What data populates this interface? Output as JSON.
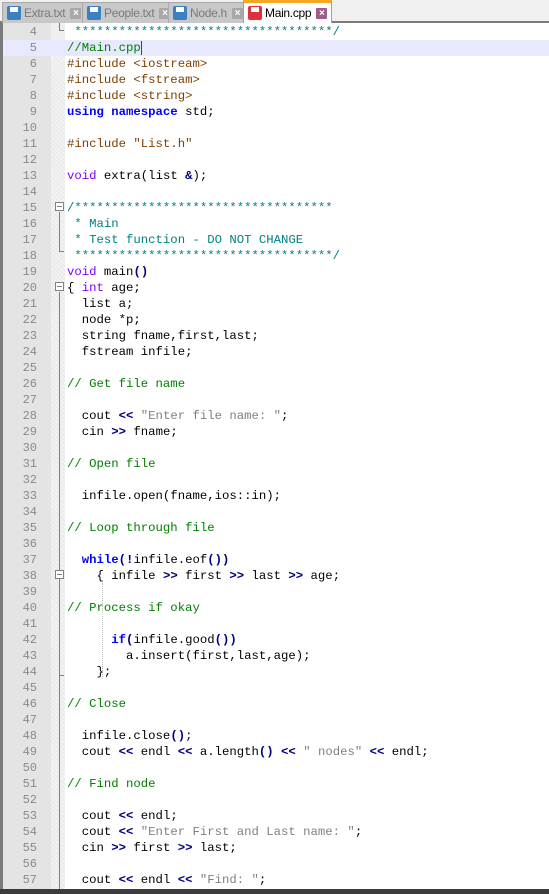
{
  "tabs": [
    {
      "label": "Extra.txt",
      "icon": "floppy-disk-icon",
      "state": "saved",
      "active": false
    },
    {
      "label": "People.txt",
      "icon": "floppy-disk-icon",
      "state": "saved",
      "active": false
    },
    {
      "label": "Node.h",
      "icon": "floppy-disk-icon",
      "state": "saved",
      "active": false
    },
    {
      "label": "Main.cpp",
      "icon": "floppy-disk-icon",
      "state": "modified",
      "active": true
    }
  ],
  "editor": {
    "current_line": 5,
    "lines": [
      {
        "n": "4",
        "tokens": [
          [
            " ***********************************/",
            "cmb"
          ]
        ]
      },
      {
        "n": "5",
        "tokens": [
          [
            "//Main.cpp",
            "cm"
          ]
        ]
      },
      {
        "n": "6",
        "tokens": [
          [
            "#include <iostream>",
            "pp"
          ]
        ]
      },
      {
        "n": "7",
        "tokens": [
          [
            "#include <fstream>",
            "pp"
          ]
        ]
      },
      {
        "n": "8",
        "tokens": [
          [
            "#include <string>",
            "pp"
          ]
        ]
      },
      {
        "n": "9",
        "tokens": [
          [
            "using namespace",
            "kw"
          ],
          [
            " std;",
            "id"
          ]
        ]
      },
      {
        "n": "10",
        "tokens": []
      },
      {
        "n": "11",
        "tokens": [
          [
            "#include \"List.h\"",
            "pp"
          ]
        ]
      },
      {
        "n": "12",
        "tokens": []
      },
      {
        "n": "13",
        "tokens": [
          [
            "void",
            "type"
          ],
          [
            " extra(list ",
            "id"
          ],
          [
            "&",
            "op"
          ],
          [
            ");",
            "id"
          ]
        ]
      },
      {
        "n": "14",
        "tokens": []
      },
      {
        "n": "15",
        "tokens": [
          [
            "/***********************************",
            "cmb"
          ]
        ]
      },
      {
        "n": "16",
        "tokens": [
          [
            " * Main",
            "cmb"
          ]
        ]
      },
      {
        "n": "17",
        "tokens": [
          [
            " * Test function - DO NOT CHANGE",
            "cmb"
          ]
        ]
      },
      {
        "n": "18",
        "tokens": [
          [
            " ***********************************/",
            "cmb"
          ]
        ]
      },
      {
        "n": "19",
        "tokens": [
          [
            "void",
            "type"
          ],
          [
            " main",
            "id"
          ],
          [
            "()",
            "op"
          ]
        ]
      },
      {
        "n": "20",
        "tokens": [
          [
            "{ ",
            "id"
          ],
          [
            "int",
            "type"
          ],
          [
            " age;",
            "id"
          ]
        ]
      },
      {
        "n": "21",
        "tokens": [
          [
            "  list a;",
            "id"
          ]
        ]
      },
      {
        "n": "22",
        "tokens": [
          [
            "  node *p;",
            "id"
          ]
        ]
      },
      {
        "n": "23",
        "tokens": [
          [
            "  string fname,first,last;",
            "id"
          ]
        ]
      },
      {
        "n": "24",
        "tokens": [
          [
            "  fstream infile;",
            "id"
          ]
        ]
      },
      {
        "n": "25",
        "tokens": []
      },
      {
        "n": "26",
        "tokens": [
          [
            "// Get file name",
            "cm"
          ]
        ]
      },
      {
        "n": "27",
        "tokens": []
      },
      {
        "n": "28",
        "tokens": [
          [
            "  cout ",
            "id"
          ],
          [
            "<<",
            "op"
          ],
          [
            " \"Enter file name: \"",
            "str"
          ],
          [
            ";",
            "id"
          ]
        ]
      },
      {
        "n": "29",
        "tokens": [
          [
            "  cin ",
            "id"
          ],
          [
            ">>",
            "op"
          ],
          [
            " fname;",
            "id"
          ]
        ]
      },
      {
        "n": "30",
        "tokens": []
      },
      {
        "n": "31",
        "tokens": [
          [
            "// Open file",
            "cm"
          ]
        ]
      },
      {
        "n": "32",
        "tokens": []
      },
      {
        "n": "33",
        "tokens": [
          [
            "  infile.open(fname,ios::in);",
            "id"
          ]
        ]
      },
      {
        "n": "34",
        "tokens": []
      },
      {
        "n": "35",
        "tokens": [
          [
            "// Loop through file",
            "cm"
          ]
        ]
      },
      {
        "n": "36",
        "tokens": []
      },
      {
        "n": "37",
        "tokens": [
          [
            "  while",
            "kw"
          ],
          [
            "(",
            "op"
          ],
          [
            "!",
            "op"
          ],
          [
            "infile.eof",
            "id"
          ],
          [
            "())",
            "op"
          ]
        ]
      },
      {
        "n": "38",
        "tokens": [
          [
            "    { infile ",
            "id"
          ],
          [
            ">>",
            "op"
          ],
          [
            " first ",
            "id"
          ],
          [
            ">>",
            "op"
          ],
          [
            " last ",
            "id"
          ],
          [
            ">>",
            "op"
          ],
          [
            " age;",
            "id"
          ]
        ]
      },
      {
        "n": "39",
        "tokens": []
      },
      {
        "n": "40",
        "tokens": [
          [
            "// Process if okay",
            "cm"
          ]
        ]
      },
      {
        "n": "41",
        "tokens": []
      },
      {
        "n": "42",
        "tokens": [
          [
            "      if",
            "kw"
          ],
          [
            "(",
            "op"
          ],
          [
            "infile.good",
            "id"
          ],
          [
            "())",
            "op"
          ]
        ]
      },
      {
        "n": "43",
        "tokens": [
          [
            "        a.insert(first,last,age);",
            "id"
          ]
        ]
      },
      {
        "n": "44",
        "tokens": [
          [
            "    };",
            "id"
          ]
        ]
      },
      {
        "n": "45",
        "tokens": []
      },
      {
        "n": "46",
        "tokens": [
          [
            "// Close",
            "cm"
          ]
        ]
      },
      {
        "n": "47",
        "tokens": []
      },
      {
        "n": "48",
        "tokens": [
          [
            "  infile.close",
            "id"
          ],
          [
            "()",
            "op"
          ],
          [
            ";",
            "id"
          ]
        ]
      },
      {
        "n": "49",
        "tokens": [
          [
            "  cout ",
            "id"
          ],
          [
            "<<",
            "op"
          ],
          [
            " endl ",
            "id"
          ],
          [
            "<<",
            "op"
          ],
          [
            " a.length",
            "id"
          ],
          [
            "()",
            "op"
          ],
          [
            " ",
            "id"
          ],
          [
            "<<",
            "op"
          ],
          [
            " \" nodes\"",
            "str"
          ],
          [
            " ",
            "id"
          ],
          [
            "<<",
            "op"
          ],
          [
            " endl;",
            "id"
          ]
        ]
      },
      {
        "n": "50",
        "tokens": []
      },
      {
        "n": "51",
        "tokens": [
          [
            "// Find node",
            "cm"
          ]
        ]
      },
      {
        "n": "52",
        "tokens": []
      },
      {
        "n": "53",
        "tokens": [
          [
            "  cout ",
            "id"
          ],
          [
            "<<",
            "op"
          ],
          [
            " endl;",
            "id"
          ]
        ]
      },
      {
        "n": "54",
        "tokens": [
          [
            "  cout ",
            "id"
          ],
          [
            "<<",
            "op"
          ],
          [
            " \"Enter First and Last name: \"",
            "str"
          ],
          [
            ";",
            "id"
          ]
        ]
      },
      {
        "n": "55",
        "tokens": [
          [
            "  cin ",
            "id"
          ],
          [
            ">>",
            "op"
          ],
          [
            " first ",
            "id"
          ],
          [
            ">>",
            "op"
          ],
          [
            " last;",
            "id"
          ]
        ]
      },
      {
        "n": "56",
        "tokens": []
      },
      {
        "n": "57",
        "tokens": [
          [
            "  cout ",
            "id"
          ],
          [
            "<<",
            "op"
          ],
          [
            " endl ",
            "id"
          ],
          [
            "<<",
            "op"
          ],
          [
            " \"Find: \"",
            "str"
          ],
          [
            ";",
            "id"
          ]
        ]
      }
    ]
  }
}
